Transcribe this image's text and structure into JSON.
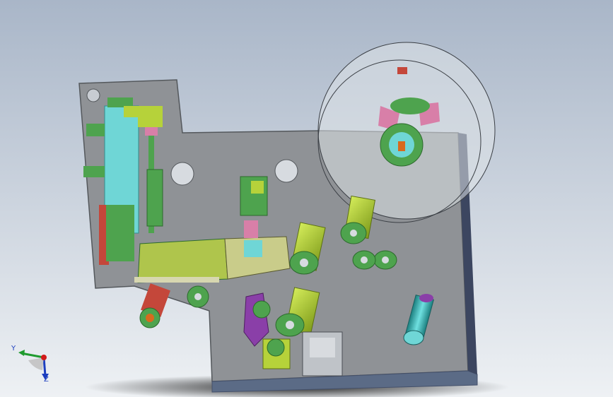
{
  "viewport": {
    "background_top": "#a9b6c8",
    "background_bottom": "#eef1f4"
  },
  "model": {
    "plate_color": "#8f9296",
    "plate_edge": "#54585c",
    "roll_disc_color": "#d6dbe2",
    "cyan": "#6fd6d6",
    "green": "#4ea34e",
    "lime": "#b6d23a",
    "pink": "#d87fa8",
    "purple": "#8a3fa8",
    "red": "#c4473a",
    "orange": "#d86a1e",
    "teal": "#2fa3a3"
  },
  "triad": {
    "y_label": "Y",
    "z_label": "Z",
    "x_color": "#1f9b2f",
    "y_color": "#1f9b2f",
    "z_color": "#1d3fbf",
    "origin_color": "#d11a1a"
  }
}
